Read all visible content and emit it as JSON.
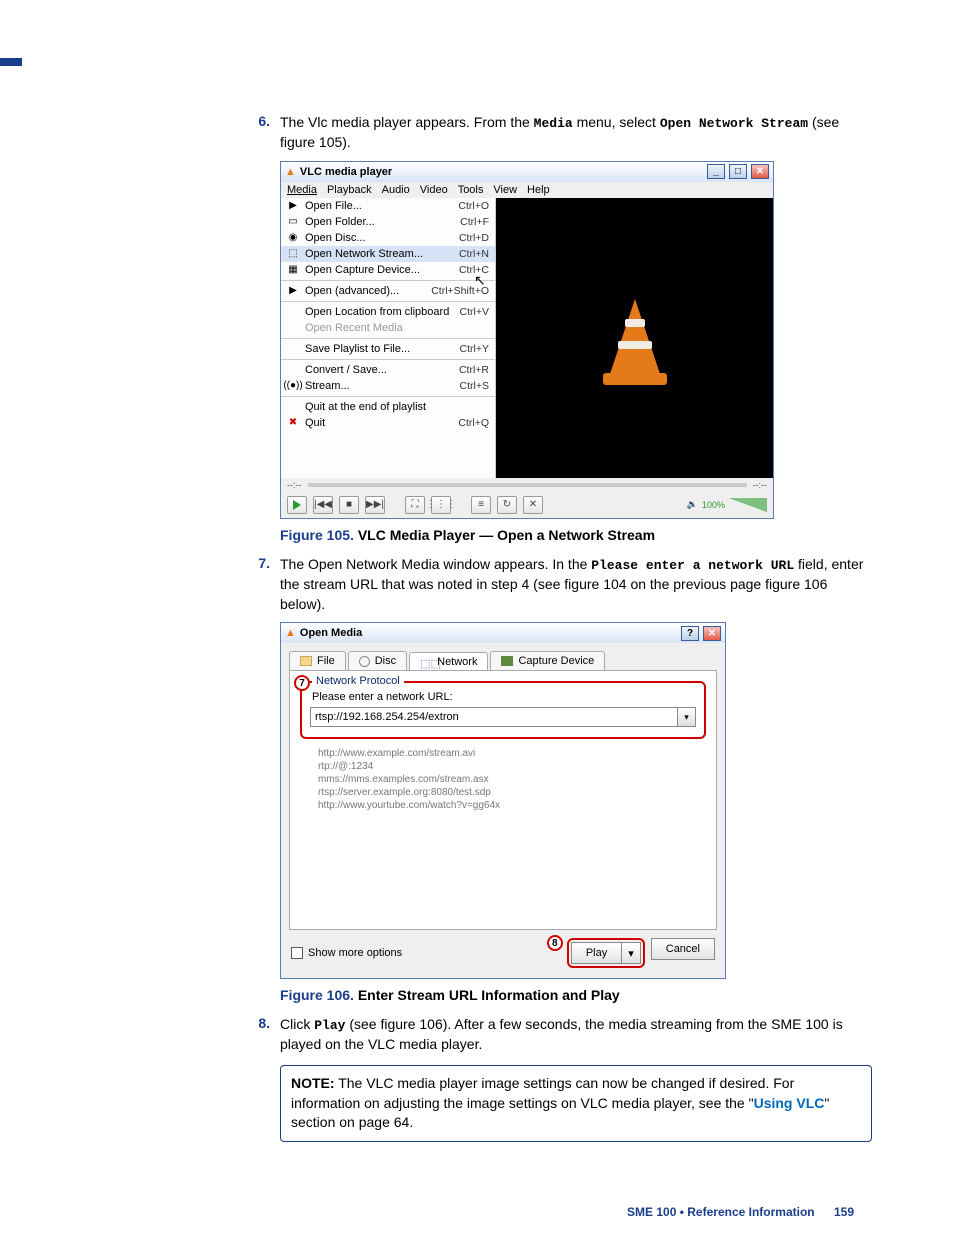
{
  "step6": {
    "num": "6.",
    "text_a": "The Vlc media player appears. From the ",
    "menu": "Media",
    "text_b": " menu, select ",
    "cmd": "Open Network Stream",
    "text_c": " (see figure 105)."
  },
  "vlc": {
    "title": "VLC media player",
    "menubar": [
      "Media",
      "Playback",
      "Audio",
      "Video",
      "Tools",
      "View",
      "Help"
    ],
    "menu": [
      {
        "label": "Open File...",
        "sc": "Ctrl+O",
        "icon": "▶",
        "type": "item"
      },
      {
        "label": "Open Folder...",
        "sc": "Ctrl+F",
        "icon": "▭",
        "type": "item"
      },
      {
        "label": "Open Disc...",
        "sc": "Ctrl+D",
        "icon": "◉",
        "type": "item"
      },
      {
        "label": "Open Network Stream...",
        "sc": "Ctrl+N",
        "icon": "⬚",
        "type": "selected"
      },
      {
        "label": "Open Capture Device...",
        "sc": "Ctrl+C",
        "icon": "▦",
        "type": "item"
      },
      {
        "type": "sep"
      },
      {
        "label": "Open (advanced)...",
        "sc": "Ctrl+Shift+O",
        "icon": "▶",
        "type": "item"
      },
      {
        "type": "sep"
      },
      {
        "label": "Open Location from clipboard",
        "sc": "Ctrl+V",
        "type": "item"
      },
      {
        "label": "Open Recent Media",
        "sc": "",
        "type": "disabled"
      },
      {
        "type": "sep"
      },
      {
        "label": "Save Playlist to File...",
        "sc": "Ctrl+Y",
        "type": "item"
      },
      {
        "type": "sep"
      },
      {
        "label": "Convert / Save...",
        "sc": "Ctrl+R",
        "type": "item"
      },
      {
        "label": "Stream...",
        "sc": "Ctrl+S",
        "icon": "((●))",
        "type": "item"
      },
      {
        "type": "sep"
      },
      {
        "label": "Quit at the end of playlist",
        "sc": "",
        "type": "item"
      },
      {
        "label": "Quit",
        "sc": "Ctrl+Q",
        "icon": "✖",
        "type": "item",
        "red": true
      }
    ],
    "track_left": "--:--",
    "track_right": "--:--",
    "vol": "100%"
  },
  "fig105": {
    "prefix": "Figure 105.",
    "text": "VLC Media Player — Open a Network Stream"
  },
  "step7": {
    "num": "7.",
    "text_a": "The Open Network Media window appears. In the ",
    "field": "Please enter a network URL",
    "text_b": " field, enter the stream URL that was noted in step 4 (see figure 104 on the previous page figure 106 below)."
  },
  "om": {
    "title": "Open Media",
    "tabs": [
      {
        "label": "File",
        "icon": "folder"
      },
      {
        "label": "Disc",
        "icon": "disc"
      },
      {
        "label": "Network",
        "icon": "net",
        "active": true
      },
      {
        "label": "Capture Device",
        "icon": "cap"
      }
    ],
    "legend": "Network Protocol",
    "label7": "7",
    "prompt": "Please enter a network URL:",
    "url": "rtsp://192.168.254.254/extron",
    "examples": [
      "http://www.example.com/stream.avi",
      "rtp://@:1234",
      "mms://mms.examples.com/stream.asx",
      "rtsp://server.example.org:8080/test.sdp",
      "http://www.yourtube.com/watch?v=gg64x"
    ],
    "show_more": "Show more options",
    "label8": "8",
    "play": "Play",
    "cancel": "Cancel"
  },
  "fig106": {
    "prefix": "Figure 106.",
    "text": "Enter Stream URL Information and Play"
  },
  "step8": {
    "num": "8.",
    "text_a": "Click ",
    "btn": "Play",
    "text_b": " (see figure 106). After a few seconds, the media streaming from the SME 100 is played on the VLC media player."
  },
  "note": {
    "label": "NOTE:",
    "text_a": " The VLC media player image settings can now be changed if desired. For information on adjusting the image settings on VLC media player, see the \"",
    "link": "Using VLC",
    "text_b": "\" section on page 64."
  },
  "footer": {
    "brand": "SME 100 • Reference Information",
    "page": "159"
  }
}
